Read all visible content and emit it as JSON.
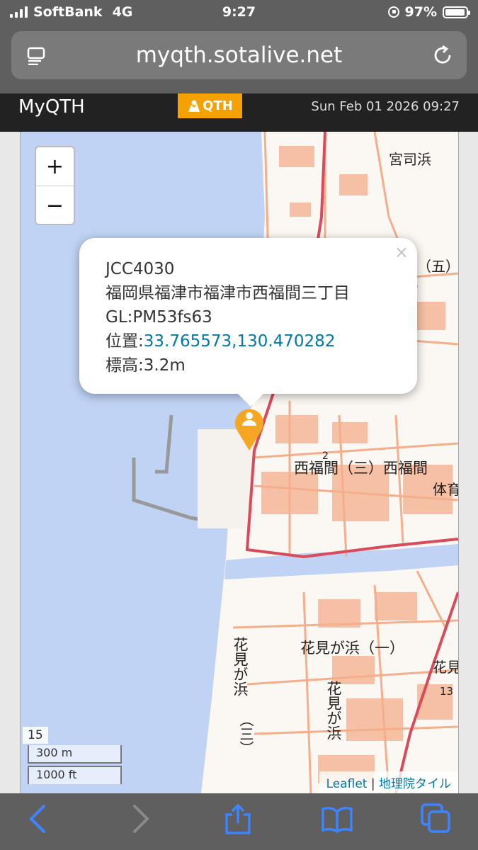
{
  "status_bar": {
    "carrier": "SoftBank",
    "network": "4G",
    "time": "9:27",
    "battery": "97%",
    "battery_level": 0.97
  },
  "browser": {
    "url": "myqth.sotalive.net",
    "icons": [
      "reader-icon",
      "reload-icon",
      "back-icon",
      "forward-icon",
      "share-icon",
      "bookmarks-icon",
      "tabs-icon"
    ]
  },
  "app": {
    "brand": "MyQTH",
    "logo_text": "QTH",
    "datetime": "Sun Feb 01 2026 09:27",
    "logo_color": "#f5a100"
  },
  "map": {
    "zoom_in": "+",
    "zoom_out": "−",
    "zoom_level": "15",
    "scale_metric": "300 m",
    "scale_imperial": "1000 ft",
    "attribution_link": "Leaflet",
    "attribution_separator": " | ",
    "attribution_tiles": "地理院タイル",
    "labels": {
      "miyajihama": "宮司浜",
      "go": "（五）",
      "nishifukuma_san": "西福間（三）西福間",
      "tai": "体育",
      "hanamigahama_ichi": "花見が浜（一）",
      "hanami_right": "花見",
      "num13": "13",
      "num2": "2",
      "hanamigahama_v": "花見が浜",
      "san_v": "（三）",
      "hanamigahama_v2": "花見が浜"
    },
    "popup": {
      "close": "×",
      "jcc": "JCC4030",
      "address": "福岡県福津市福津市西福間三丁目",
      "grid": "GL:PM53fs63",
      "position_label": "位置:",
      "position": "33.765573,130.470282",
      "elevation": "標高:3.2m"
    },
    "colors": {
      "sea": "#c0d3f5",
      "road": "#f5ae8c",
      "boundary": "#d94a5a",
      "marker": "#f5a623"
    }
  }
}
